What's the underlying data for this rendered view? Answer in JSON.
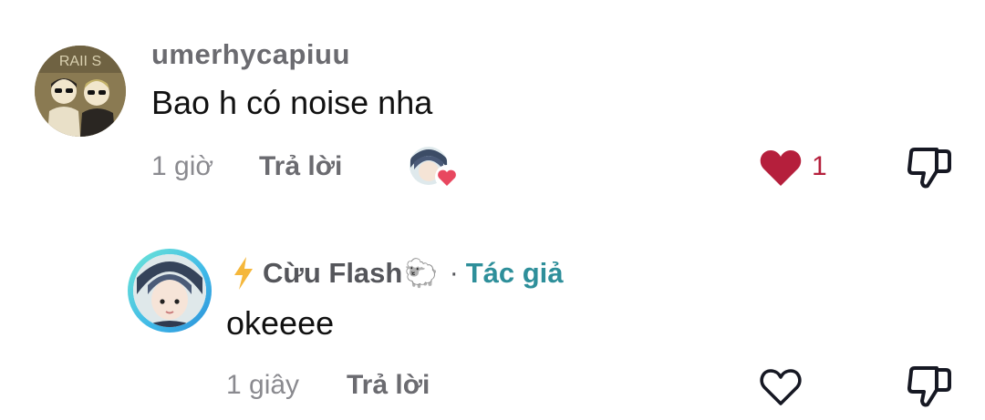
{
  "comments": [
    {
      "username": "umerhycapiuu",
      "text": "Bao h có noise nha",
      "time": "1 giờ",
      "reply_label": "Trả lời",
      "avatar_caption": "RAII S",
      "like_count": "1",
      "liked": true,
      "liked_by_creator": true
    }
  ],
  "reply": {
    "author_name": "Cừu Flash",
    "author_emoji": "🐑",
    "separator": "·",
    "author_badge": "Tác giả",
    "text": "okeeee",
    "time": "1 giây",
    "reply_label": "Trả lời",
    "liked": false
  },
  "colors": {
    "like_red": "#b51f3c",
    "author_teal": "#2e8f9a",
    "bolt_yellow": "#f5b73b"
  },
  "icons": [
    "heart-filled-icon",
    "heart-outline-icon",
    "dislike-icon",
    "lightning-bolt-icon"
  ]
}
